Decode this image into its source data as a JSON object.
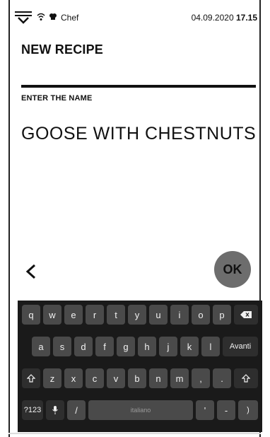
{
  "status": {
    "app_name": "Chef",
    "date": "04.09.2020",
    "time": "17.15",
    "icons": [
      "notifications-chevron-icon",
      "wifi-icon",
      "chef-hat-icon"
    ]
  },
  "page": {
    "title": "NEW RECIPE",
    "field_label": "ENTER THE NAME",
    "field_value": "GOOSE WITH CHESTNUTS",
    "ok_label": "OK"
  },
  "keyboard": {
    "row1": [
      "q",
      "w",
      "e",
      "r",
      "t",
      "y",
      "u",
      "i",
      "o",
      "p"
    ],
    "row2": [
      "a",
      "s",
      "d",
      "f",
      "g",
      "h",
      "j",
      "k",
      "l"
    ],
    "row2_action": "Avanti",
    "row3": [
      "z",
      "x",
      "c",
      "v",
      "b",
      "n",
      "m",
      ",",
      "."
    ],
    "row4_symbols": "?123",
    "row4_slash": "/",
    "space_label": "italiano",
    "row4_apostrophe": "'",
    "row4_dash": "-",
    "row4_paren": ")"
  },
  "colors": {
    "keyboard_bg": "#1a1a1a",
    "key_bg": "#4a4a4a",
    "ok_button_bg": "#6d6d6d"
  }
}
